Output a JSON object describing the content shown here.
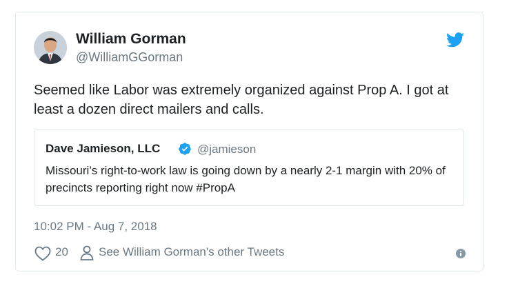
{
  "author": {
    "name": "William Gorman",
    "handle": "@WilliamGGorman"
  },
  "tweet": {
    "text": "Seemed like Labor was extremely organized against Prop A. I got at least a dozen direct mailers and calls."
  },
  "quoted_tweet": {
    "name": "Dave Jamieson, LLC",
    "handle": "@jamieson",
    "text": "Missouri’s right-to-work law is going down by a nearly 2-1 margin with 20% of precincts reporting right now #PropA"
  },
  "timestamp": "10:02 PM - Aug 7, 2018",
  "actions": {
    "like_count": "20",
    "other_tweets_label": "See William Gorman's other Tweets"
  },
  "colors": {
    "twitter_blue": "#1da1f2",
    "muted": "#697882",
    "text": "#1c2022",
    "border": "#e1e8ed"
  },
  "icons": {
    "brand": "twitter-bird-icon",
    "verified": "verified-badge-icon",
    "like": "heart-icon",
    "profile": "person-icon",
    "info": "info-icon"
  }
}
